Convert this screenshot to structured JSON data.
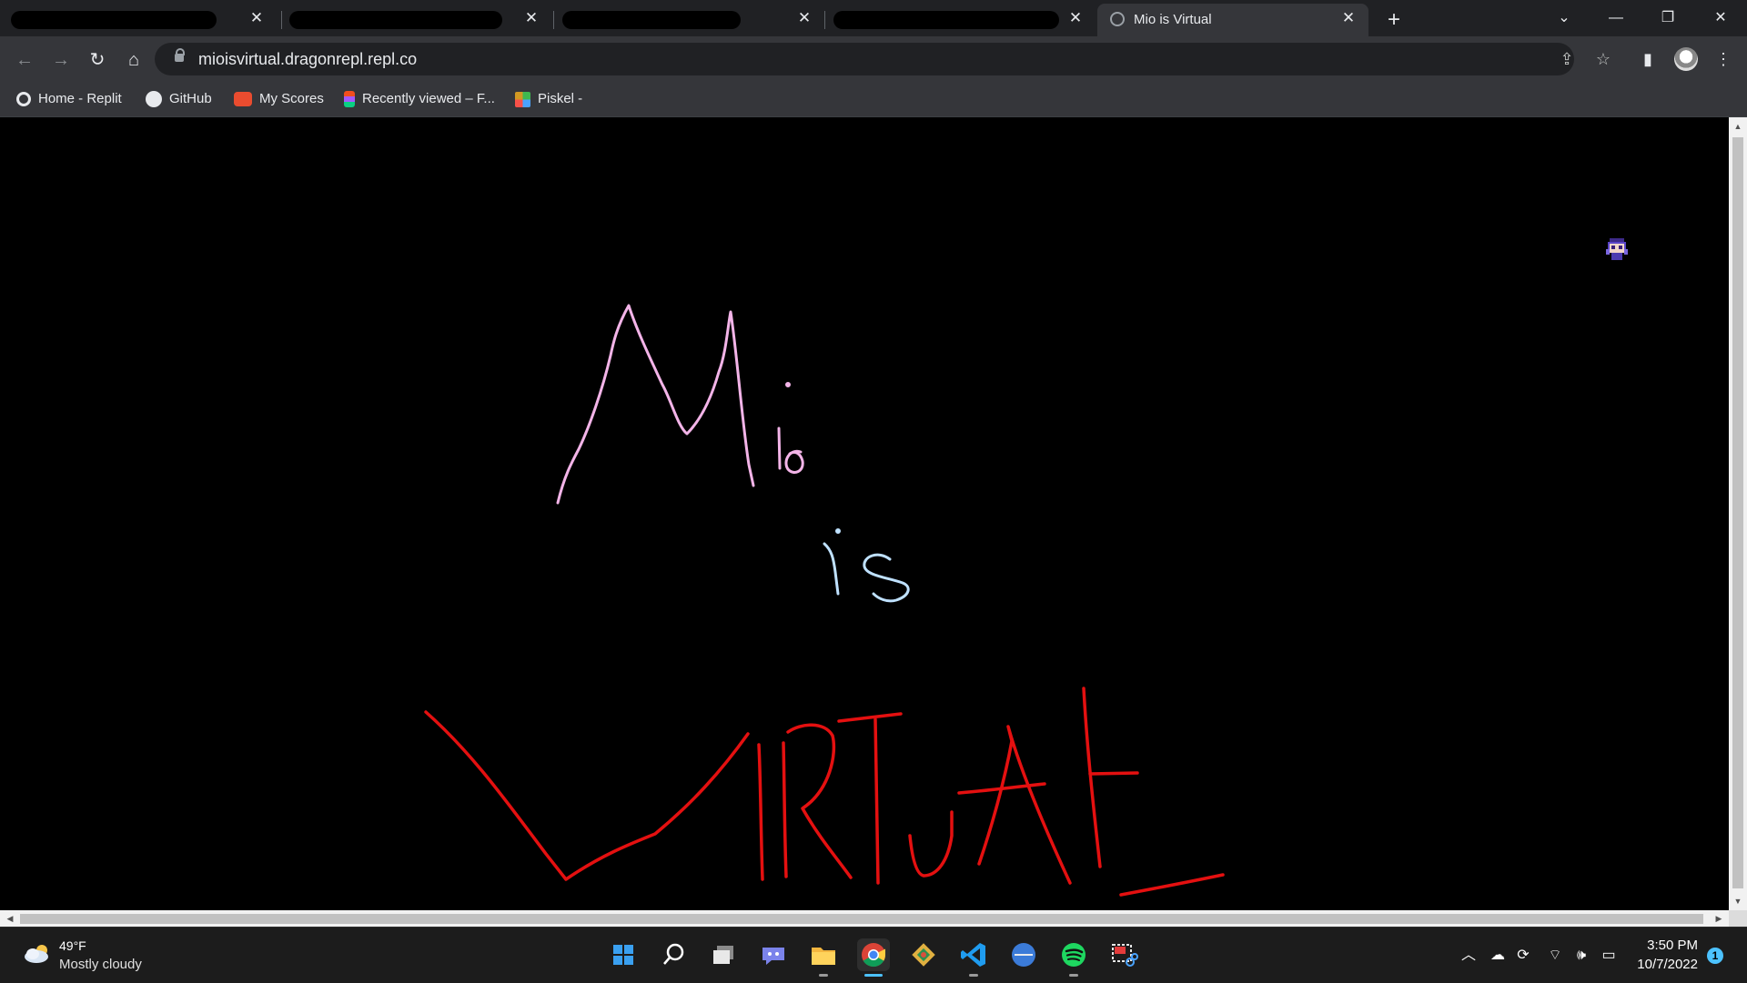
{
  "browser": {
    "tabs": [
      {
        "title": "",
        "redacted": true
      },
      {
        "title": "",
        "redacted": true
      },
      {
        "title": "",
        "redacted": true
      },
      {
        "title": "",
        "redacted": true
      },
      {
        "title": "Mio is Virtual",
        "active": true,
        "favicon": "globe-icon"
      }
    ],
    "address": "mioisvirtual.dragonrepl.repl.co",
    "bookmarks": [
      {
        "label": "Home - Replit",
        "icon": "replit-icon"
      },
      {
        "label": "GitHub",
        "icon": "github-icon"
      },
      {
        "label": "My Scores",
        "icon": "scores-icon"
      },
      {
        "label": "Recently viewed – F...",
        "icon": "figma-icon"
      },
      {
        "label": "Piskel -",
        "icon": "piskel-icon"
      }
    ]
  },
  "page": {
    "drawing_words": [
      "Mio",
      "is",
      "VIRTUAL"
    ],
    "colors": {
      "mio": "#f3b4e8",
      "is": "#bfe1ff",
      "virtual": "#e41010",
      "background": "#000000"
    }
  },
  "taskbar": {
    "weather": {
      "temp": "49°F",
      "condition": "Mostly cloudy"
    },
    "apps": [
      "windows-start-icon",
      "search-icon",
      "task-view-icon",
      "teams-chat-icon",
      "file-explorer-icon",
      "chrome-icon",
      "git-icon",
      "vscode-icon",
      "app-icon",
      "spotify-icon",
      "snipping-tool-icon"
    ],
    "clock": {
      "time": "3:50 PM",
      "date": "10/7/2022"
    },
    "notification_count": "1"
  }
}
